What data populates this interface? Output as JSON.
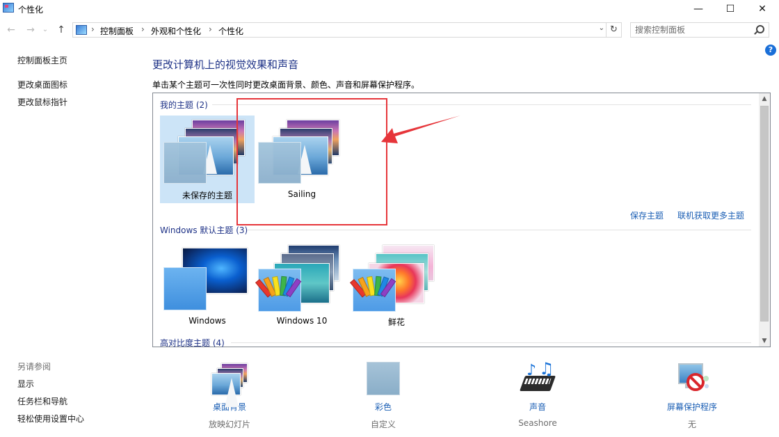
{
  "window": {
    "title": "个性化",
    "minimize": "—",
    "maximize": "☐",
    "close": "✕"
  },
  "nav": {
    "back": "←",
    "forward": "→",
    "recent": "⌄",
    "up": "↑",
    "refresh": "↻",
    "breadcrumb": [
      "控制面板",
      "外观和个性化",
      "个性化"
    ],
    "separator": "›",
    "dropdown": "⌄"
  },
  "search": {
    "placeholder": "搜索控制面板"
  },
  "help": "?",
  "sidebar": {
    "links": [
      "控制面板主页",
      "更改桌面图标",
      "更改鼠标指针"
    ],
    "see_also_title": "另请参阅",
    "see_also": [
      "显示",
      "任务栏和导航",
      "轻松使用设置中心"
    ]
  },
  "main": {
    "heading": "更改计算机上的视觉效果和声音",
    "subtitle": "单击某个主题可一次性同时更改桌面背景、颜色、声音和屏幕保护程序。"
  },
  "groups": {
    "my_themes": {
      "label": "我的主题",
      "count": "(2)",
      "themes": [
        {
          "name": "未保存的主题",
          "selected": true
        },
        {
          "name": "Sailing",
          "selected": false
        }
      ],
      "actions": [
        "保存主题",
        "联机获取更多主题"
      ]
    },
    "windows_default": {
      "label": "Windows 默认主题",
      "count": "(3)",
      "themes": [
        {
          "name": "Windows"
        },
        {
          "name": "Windows 10"
        },
        {
          "name": "鲜花"
        }
      ]
    },
    "high_contrast": {
      "label": "高对比度主题",
      "count": "(4)"
    }
  },
  "bottom": [
    {
      "title": "桌面背景",
      "sub": "放映幻灯片",
      "icon": "desktop-background-icon"
    },
    {
      "title": "彩色",
      "sub": "自定义",
      "icon": "color-swatch-icon"
    },
    {
      "title": "声音",
      "sub": "Seashore",
      "icon": "sound-icon"
    },
    {
      "title": "屏幕保护程序",
      "sub": "无",
      "icon": "screensaver-icon"
    }
  ],
  "colors": {
    "link": "#1a5eb4",
    "heading": "#1e3287",
    "selected": "#cce4f7",
    "annotation": "#e6353a"
  }
}
